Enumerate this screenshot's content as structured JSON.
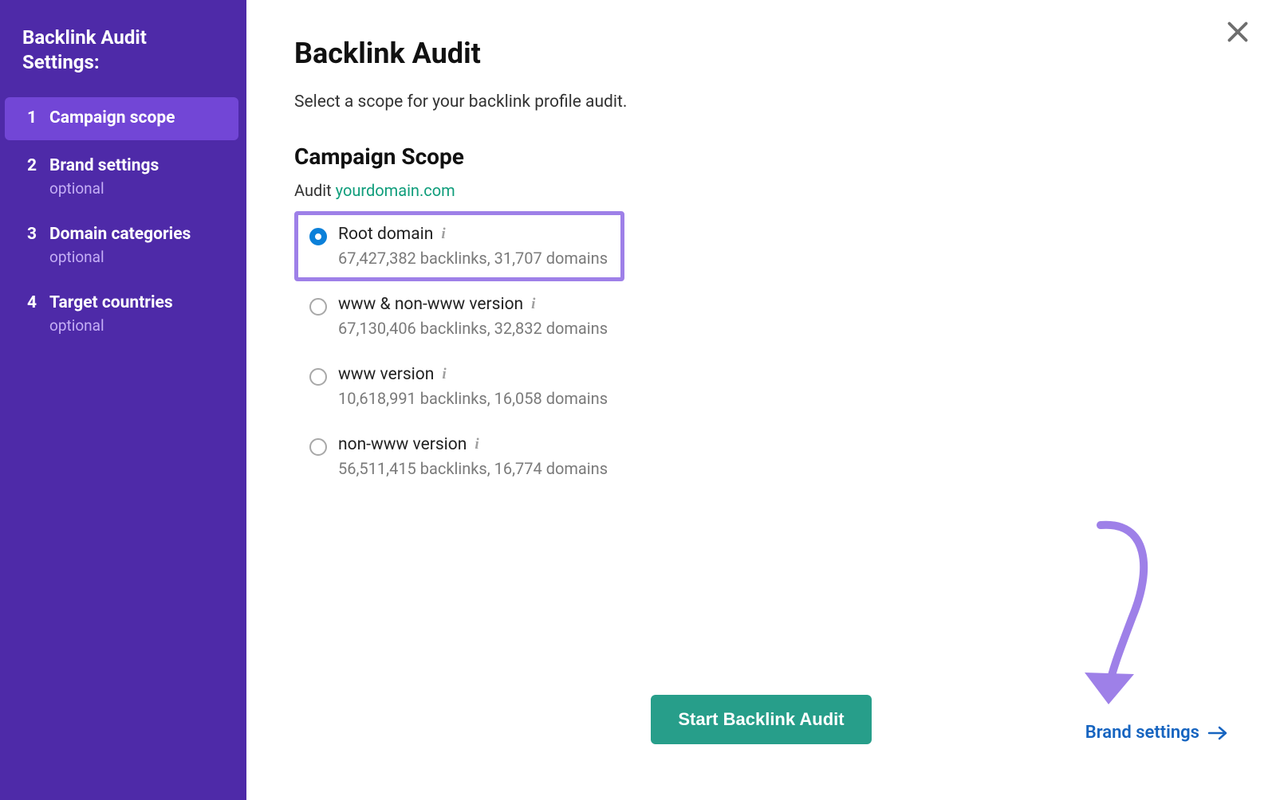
{
  "sidebar": {
    "title": "Backlink Audit Settings:",
    "items": [
      {
        "num": "1",
        "label": "Campaign scope",
        "sublabel": "",
        "active": true
      },
      {
        "num": "2",
        "label": "Brand settings",
        "sublabel": "optional",
        "active": false
      },
      {
        "num": "3",
        "label": "Domain categories",
        "sublabel": "optional",
        "active": false
      },
      {
        "num": "4",
        "label": "Target countries",
        "sublabel": "optional",
        "active": false
      }
    ]
  },
  "main": {
    "title": "Backlink Audit",
    "description": "Select a scope for your backlink profile audit.",
    "section_heading": "Campaign Scope",
    "audit_prefix": "Audit ",
    "audit_domain": "yourdomain.com",
    "options": [
      {
        "label": "Root domain",
        "stats": "67,427,382 backlinks, 31,707 domains",
        "selected": true,
        "highlighted": true
      },
      {
        "label": "www & non-www version",
        "stats": "67,130,406 backlinks, 32,832 domains",
        "selected": false,
        "highlighted": false
      },
      {
        "label": "www version",
        "stats": "10,618,991 backlinks, 16,058 domains",
        "selected": false,
        "highlighted": false
      },
      {
        "label": "non-www version",
        "stats": "56,511,415 backlinks, 16,774 domains",
        "selected": false,
        "highlighted": false
      }
    ]
  },
  "footer": {
    "primary_button": "Start Backlink Audit",
    "next_link": "Brand settings"
  }
}
